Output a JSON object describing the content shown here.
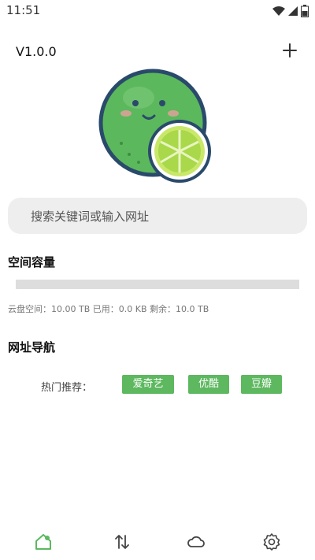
{
  "status_bar": {
    "time": "11:51",
    "icons": [
      "wifi-icon",
      "signal-icon",
      "battery-icon"
    ]
  },
  "header": {
    "version": "V1.0.0",
    "add_icon": "plus-icon"
  },
  "search": {
    "placeholder": "搜索关键词或输入网址"
  },
  "capacity": {
    "title": "空间容量",
    "used_fraction": 0.0,
    "info": "云盘空间：10.00 TB 已用：0.0 KB 剩余：10.0 TB"
  },
  "navigation": {
    "title": "网址导航",
    "hot_label": "热门推荐：",
    "links": [
      "爱奇艺",
      "优酷",
      "豆瓣"
    ]
  },
  "bottom_nav": {
    "items": [
      "home-icon",
      "transfer-icon",
      "cloud-icon",
      "settings-icon"
    ],
    "active": "home-icon"
  },
  "colors": {
    "accent": "#5db85f",
    "progress_track": "#dddddd",
    "search_bg": "#eeeeee"
  }
}
